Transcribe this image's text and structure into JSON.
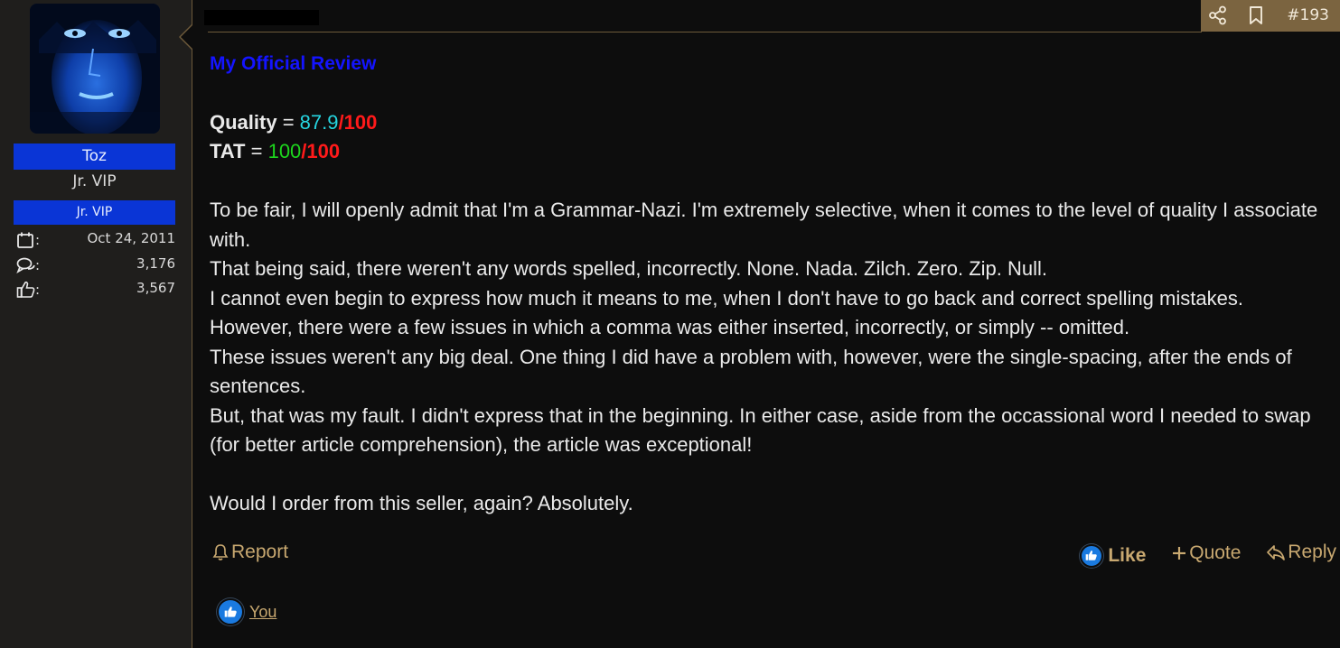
{
  "user": {
    "name": "Toz",
    "title": "Jr. VIP",
    "banner": "Jr. VIP",
    "joined": "Oct 24, 2011",
    "messages": "3,176",
    "reactions": "3,567",
    "stat_separator": ":"
  },
  "post": {
    "number": "#193",
    "heading": "My Official Review",
    "quality_label": "Quality",
    "quality_score": "87.9",
    "quality_max": "/100",
    "tat_label": "TAT",
    "tat_score": "100",
    "tat_max": "/100",
    "equals": " = ",
    "paragraphs": [
      "To be fair, I will openly admit that I'm a Grammar-Nazi. I'm extremely selective, when it comes to the level of quality I associate with.",
      "That being said, there weren't any words spelled, incorrectly. None. Nada. Zilch. Zero. Zip. Null.",
      "I cannot even begin to express how much it means to me, when I don't have to go back and correct spelling mistakes.",
      "However, there were a few issues in which a comma was either inserted, incorrectly, or simply -- omitted.",
      "These issues weren't any big deal. One thing I did have a problem with, however, were the single-spacing, after the ends of sentences.",
      "But, that was my fault. I didn't express that in the beginning. In either case, aside from the occassional word I needed to swap (for better article comprehension), the article was exceptional!"
    ],
    "closing": "Would I order from this seller, again? Absolutely."
  },
  "actions": {
    "report": "Report",
    "like": "Like",
    "quote": "Quote",
    "reply": "Reply"
  },
  "reactions_line": {
    "who": "You"
  },
  "colors": {
    "accent": "#c8a870",
    "user_banner": "#0a35d6",
    "heading": "#1414ff",
    "quality_score": "#26d5e0",
    "tat_score": "#1dd61d",
    "max_score": "#ff1a1a"
  }
}
